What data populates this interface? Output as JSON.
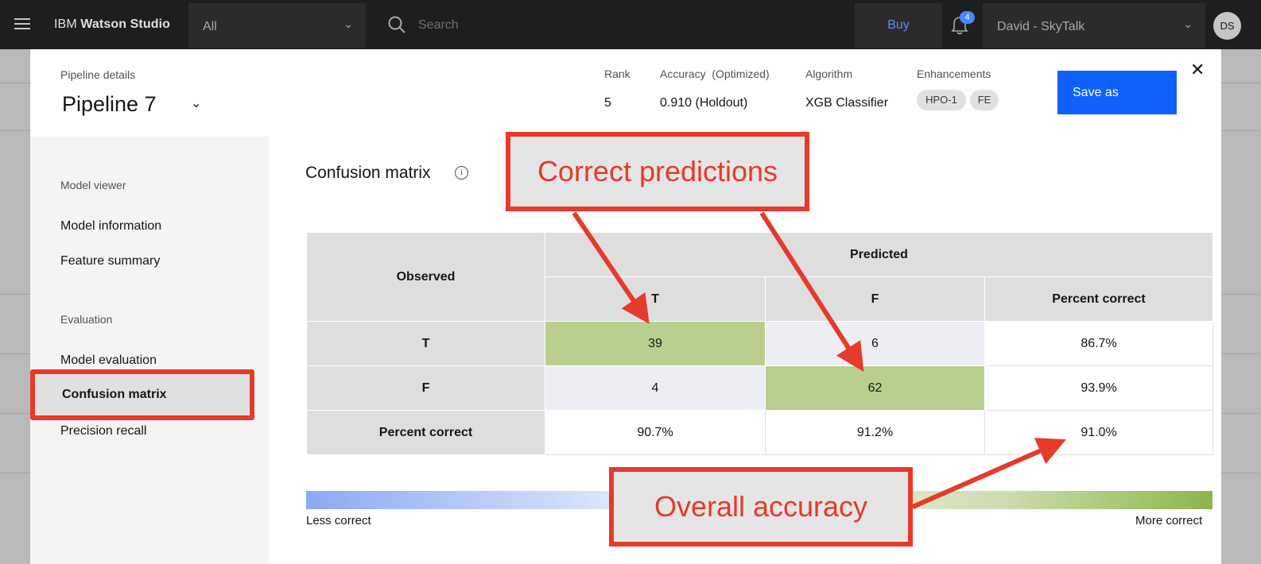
{
  "topbar": {
    "brand_prefix": "IBM",
    "brand_name": "Watson Studio",
    "scope": "All",
    "search_placeholder": "Search",
    "buy": "Buy",
    "notification_count": "4",
    "account": "David - SkyTalk",
    "avatar_initials": "DS"
  },
  "header": {
    "section_label": "Pipeline details",
    "pipeline_name": "Pipeline 7",
    "rank_label": "Rank",
    "rank_value": "5",
    "accuracy_label": "Accuracy  (Optimized)",
    "accuracy_value": "0.910 (Holdout)",
    "algorithm_label": "Algorithm",
    "algorithm_value": "XGB Classifier",
    "enhancements_label": "Enhancements",
    "enhancements": [
      "HPO-1",
      "FE"
    ],
    "save_label": "Save as",
    "close_glyph": "✕"
  },
  "sidebar": {
    "model_viewer_heading": "Model viewer",
    "model_information": "Model information",
    "feature_summary": "Feature summary",
    "evaluation_heading": "Evaluation",
    "model_evaluation": "Model evaluation",
    "confusion_matrix": "Confusion matrix",
    "precision_recall": "Precision recall"
  },
  "matrix": {
    "title": "Confusion matrix",
    "info_glyph": "i",
    "observed_header": "Observed",
    "predicted_header": "Predicted",
    "col_t": "T",
    "col_f": "F",
    "col_pct": "Percent correct",
    "rows": [
      {
        "label": "T",
        "t": "39",
        "f": "6",
        "pct": "86.7%"
      },
      {
        "label": "F",
        "t": "4",
        "f": "62",
        "pct": "93.9%"
      },
      {
        "label": "Percent correct",
        "t": "90.7%",
        "f": "91.2%",
        "pct": "91.0%"
      }
    ],
    "legend_left": "Less correct",
    "legend_right": "More correct"
  },
  "callouts": {
    "correct_predictions": "Correct predictions",
    "overall_accuracy": "Overall accuracy"
  },
  "colors": {
    "callout_red": "#e63a2b",
    "correct_cell": "#b8cf8f",
    "incorrect_cell": "#eceef4",
    "primary_button": "#0f62fe"
  }
}
